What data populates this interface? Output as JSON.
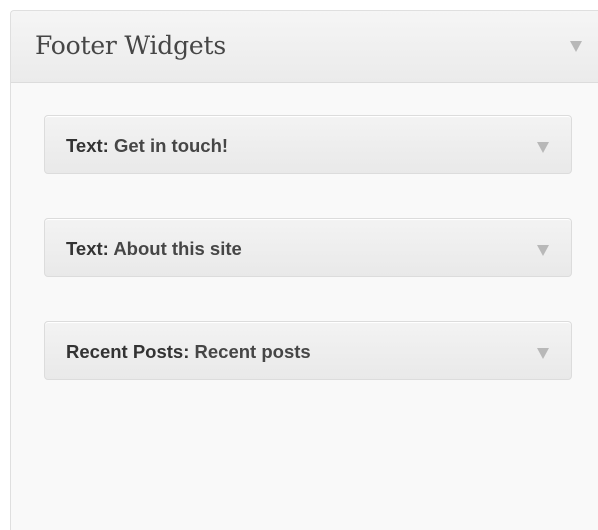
{
  "sidebar": {
    "title": "Footer Widgets",
    "toggle_icon": "triangle-down-icon",
    "widgets": [
      {
        "name": "Text",
        "separator": ":",
        "title": "Get in touch!",
        "toggle_icon": "triangle-down-icon"
      },
      {
        "name": "Text",
        "separator": ":",
        "title": "About this site",
        "toggle_icon": "triangle-down-icon"
      },
      {
        "name": "Recent Posts",
        "separator": ":",
        "title": "Recent posts",
        "toggle_icon": "triangle-down-icon"
      }
    ]
  },
  "colors": {
    "panel_background": "#f9f9f9",
    "header_background": "#ebebeb",
    "border": "#dfdfdf",
    "text": "#464646",
    "arrow": "#b8b8b8"
  }
}
